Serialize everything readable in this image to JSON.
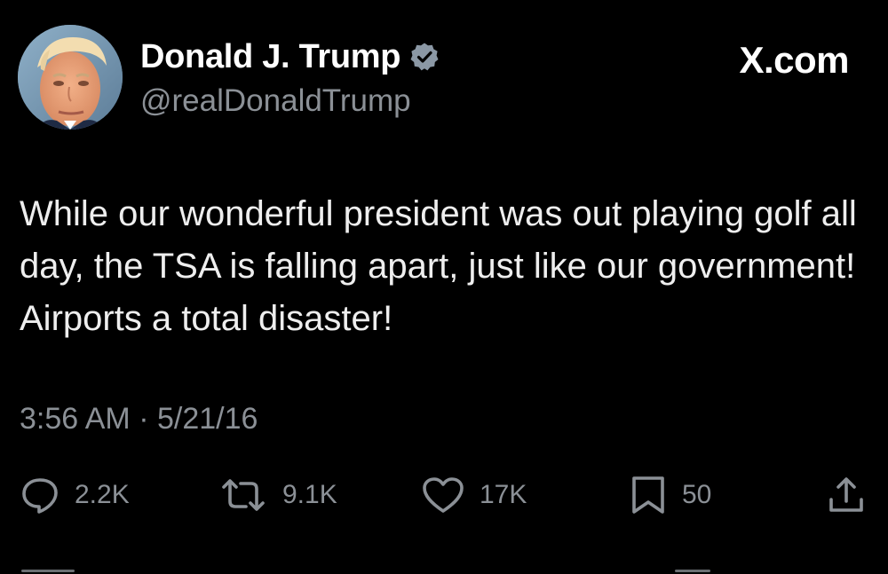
{
  "tweet": {
    "display_name": "Donald J. Trump",
    "handle": "@realDonaldTrump",
    "verified": true,
    "brand": "X.com",
    "text": "While our wonderful president was out playing golf all day, the TSA is falling apart, just like our government! Airports a total disaster!",
    "timestamp": "3:56 AM · 5/21/16"
  },
  "actions": {
    "replies": "2.2K",
    "reposts": "9.1K",
    "likes": "17K",
    "bookmarks": "50"
  },
  "icons": {
    "reply": "reply-icon",
    "repost": "repost-icon",
    "like": "heart-icon",
    "bookmark": "bookmark-icon",
    "share": "share-icon",
    "verified": "verified-badge-icon"
  },
  "colors": {
    "background": "#000000",
    "primary_text": "#ffffff",
    "secondary_text": "#8b9096",
    "verified_badge": "#8b98a5"
  }
}
